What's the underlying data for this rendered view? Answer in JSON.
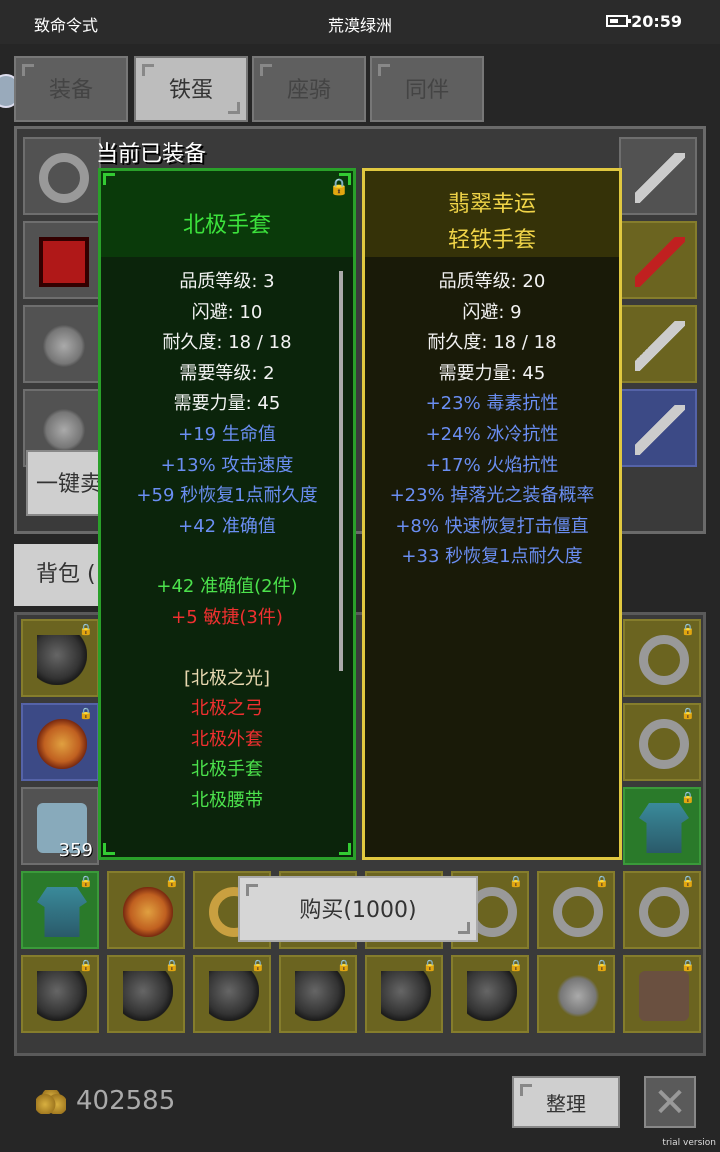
{
  "status_bar": {
    "left": "致命令式",
    "center": "荒漠绿洲",
    "time": "20:59"
  },
  "tabs": [
    {
      "label": "装备",
      "active": false
    },
    {
      "label": "铁蛋",
      "active": true
    },
    {
      "label": "座骑",
      "active": false
    },
    {
      "label": "同伴",
      "active": false
    }
  ],
  "equipped_title": "当前已装备",
  "sell_button": "一键卖",
  "bag_tab": "背包 (",
  "left_item": {
    "name": "北极手套",
    "stats": [
      "品质等级: 3",
      "闪避: 10",
      "耐久度: 18 / 18",
      "需要等级: 2",
      "需要力量: 45"
    ],
    "bonuses": [
      "+19 生命值",
      "+13% 攻击速度",
      "+59 秒恢复1点耐久度",
      "+42 准确值"
    ],
    "set_bonus_active": "+42 准确值(2件)",
    "set_bonus_inactive": "+5 敏捷(3件)",
    "set_name": "[北极之光]",
    "set_pieces": [
      {
        "name": "北极之弓",
        "owned": false
      },
      {
        "name": "北极外套",
        "owned": false
      },
      {
        "name": "北极手套",
        "owned": true
      },
      {
        "name": "北极腰带",
        "owned": true
      }
    ]
  },
  "right_item": {
    "name_line1": "翡翠幸运",
    "name_line2": "轻铁手套",
    "stats": [
      "品质等级: 20",
      "闪避: 9",
      "耐久度: 18 / 18",
      "需要力量: 45"
    ],
    "bonuses": [
      "+23% 毒素抗性",
      "+24% 冰冷抗性",
      "+17% 火焰抗性",
      "+23% 掉落光之装备概率",
      "+8% 快速恢复打击僵直",
      "+33 秒恢复1点耐久度"
    ]
  },
  "buy_button": "购买(1000)",
  "bag_count": "359",
  "gold": "402585",
  "sort_button": "整理",
  "close_icon": "close-icon",
  "watermark": "trial version"
}
